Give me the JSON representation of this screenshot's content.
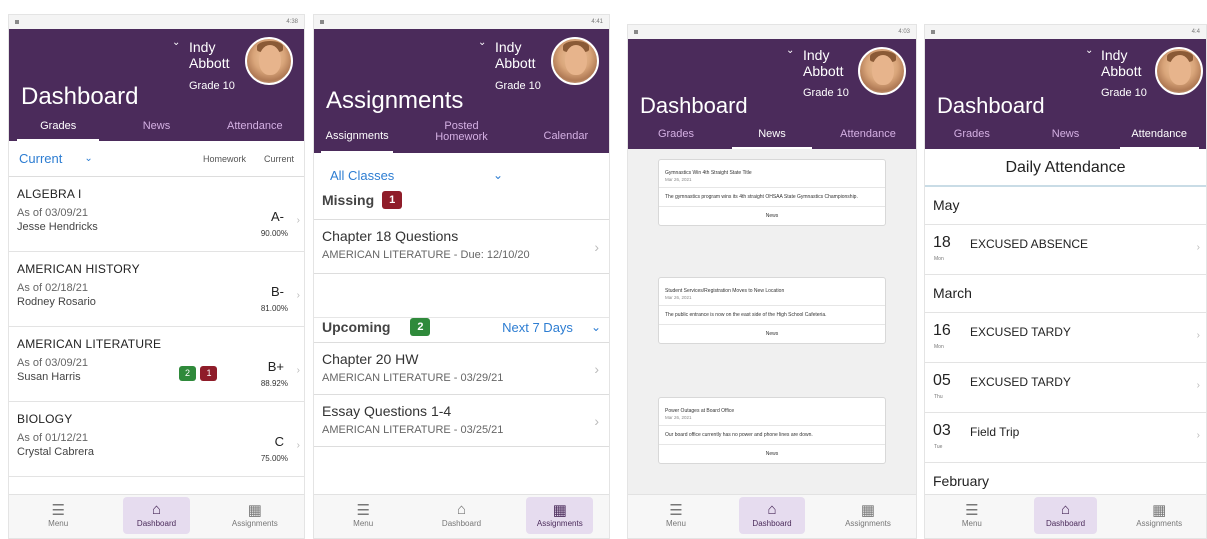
{
  "screen1": {
    "status_time": "4:38",
    "title": "Dashboard",
    "user": {
      "first": "Indy",
      "last": "Abbott",
      "grade": "Grade 10"
    },
    "tabs": [
      "Grades",
      "News",
      "Attendance"
    ],
    "filter": {
      "term": "Current",
      "col1": "Homework",
      "col2": "Current"
    },
    "courses": [
      {
        "name": "ALGEBRA I",
        "as_of": "As of 03/09/21",
        "teacher": "Jesse Hendricks",
        "grade": "A-",
        "pct": "90.00%"
      },
      {
        "name": "AMERICAN HISTORY",
        "as_of": "As of 02/18/21",
        "teacher": "Rodney Rosario",
        "grade": "B-",
        "pct": "81.00%"
      },
      {
        "name": "AMERICAN LITERATURE",
        "as_of": "As of 03/09/21",
        "teacher": "Susan Harris",
        "grade": "B+",
        "pct": "88.92%",
        "badge_green": "2",
        "badge_red": "1"
      },
      {
        "name": "BIOLOGY",
        "as_of": "As of 01/12/21",
        "teacher": "Crystal Cabrera",
        "grade": "C",
        "pct": "75.00%"
      }
    ]
  },
  "screen2": {
    "status_time": "4:41",
    "title": "Assignments",
    "user": {
      "first": "Indy",
      "last": "Abbott",
      "grade": "Grade 10"
    },
    "tabs": [
      "Assignments",
      "Posted Homework",
      "Calendar"
    ],
    "filter": "All Classes",
    "missing_label": "Missing",
    "missing_count": "1",
    "missing": [
      {
        "title": "Chapter 18 Questions",
        "sub": "AMERICAN LITERATURE - Due: 12/10/20"
      }
    ],
    "upcoming_label": "Upcoming",
    "upcoming_count": "2",
    "upcoming_range": "Next 7 Days",
    "upcoming": [
      {
        "title": "Chapter 20 HW",
        "sub": "AMERICAN LITERATURE - 03/29/21"
      },
      {
        "title": "Essay Questions 1-4",
        "sub": "AMERICAN LITERATURE - 03/25/21"
      }
    ]
  },
  "screen3": {
    "status_time": "4:03",
    "title": "Dashboard",
    "user": {
      "first": "Indy",
      "last": "Abbott",
      "grade": "Grade 10"
    },
    "tabs": [
      "Grades",
      "News",
      "Attendance"
    ],
    "news": [
      {
        "title": "Gymnastics Win 4th Straight State Title",
        "date": "Mar 26, 2021",
        "body": "The gymnastics program wins its 4th straight OHSAA State Gymnastics Championship.",
        "footer": "News"
      },
      {
        "title": "Student Services/Registration Moves to New Location",
        "date": "Mar 26, 2021",
        "body": "The public entrance is now on the east side of the High School Cafeteria.",
        "footer": "News"
      },
      {
        "title": "Power Outages at Board Office",
        "date": "Mar 26, 2021",
        "body": "Our board office currently has no power and phone lines are down.",
        "footer": "News"
      }
    ]
  },
  "screen4": {
    "status_time": "4:4",
    "title": "Dashboard",
    "user": {
      "first": "Indy",
      "last": "Abbott",
      "grade": "Grade 10"
    },
    "tabs": [
      "Grades",
      "News",
      "Attendance"
    ],
    "section_title": "Daily Attendance",
    "months": {
      "may": "May",
      "march": "March",
      "february": "February"
    },
    "records": [
      {
        "day": "18",
        "dow": "Mon",
        "text": "EXCUSED ABSENCE"
      },
      {
        "day": "16",
        "dow": "Mon",
        "text": "EXCUSED TARDY"
      },
      {
        "day": "05",
        "dow": "Thu",
        "text": "EXCUSED TARDY"
      },
      {
        "day": "03",
        "dow": "Tue",
        "text": "Field Trip"
      }
    ]
  },
  "bottom_nav": [
    "Menu",
    "Dashboard",
    "Assignments"
  ],
  "icons": {
    "menu": "hamburger-icon",
    "dashboard": "home-icon",
    "assignments": "notebook-icon"
  },
  "colors": {
    "header": "#4b2b5b",
    "accent": "#2d7dd2",
    "badge_green": "#2f8a3b",
    "badge_red": "#8f1d2a"
  }
}
